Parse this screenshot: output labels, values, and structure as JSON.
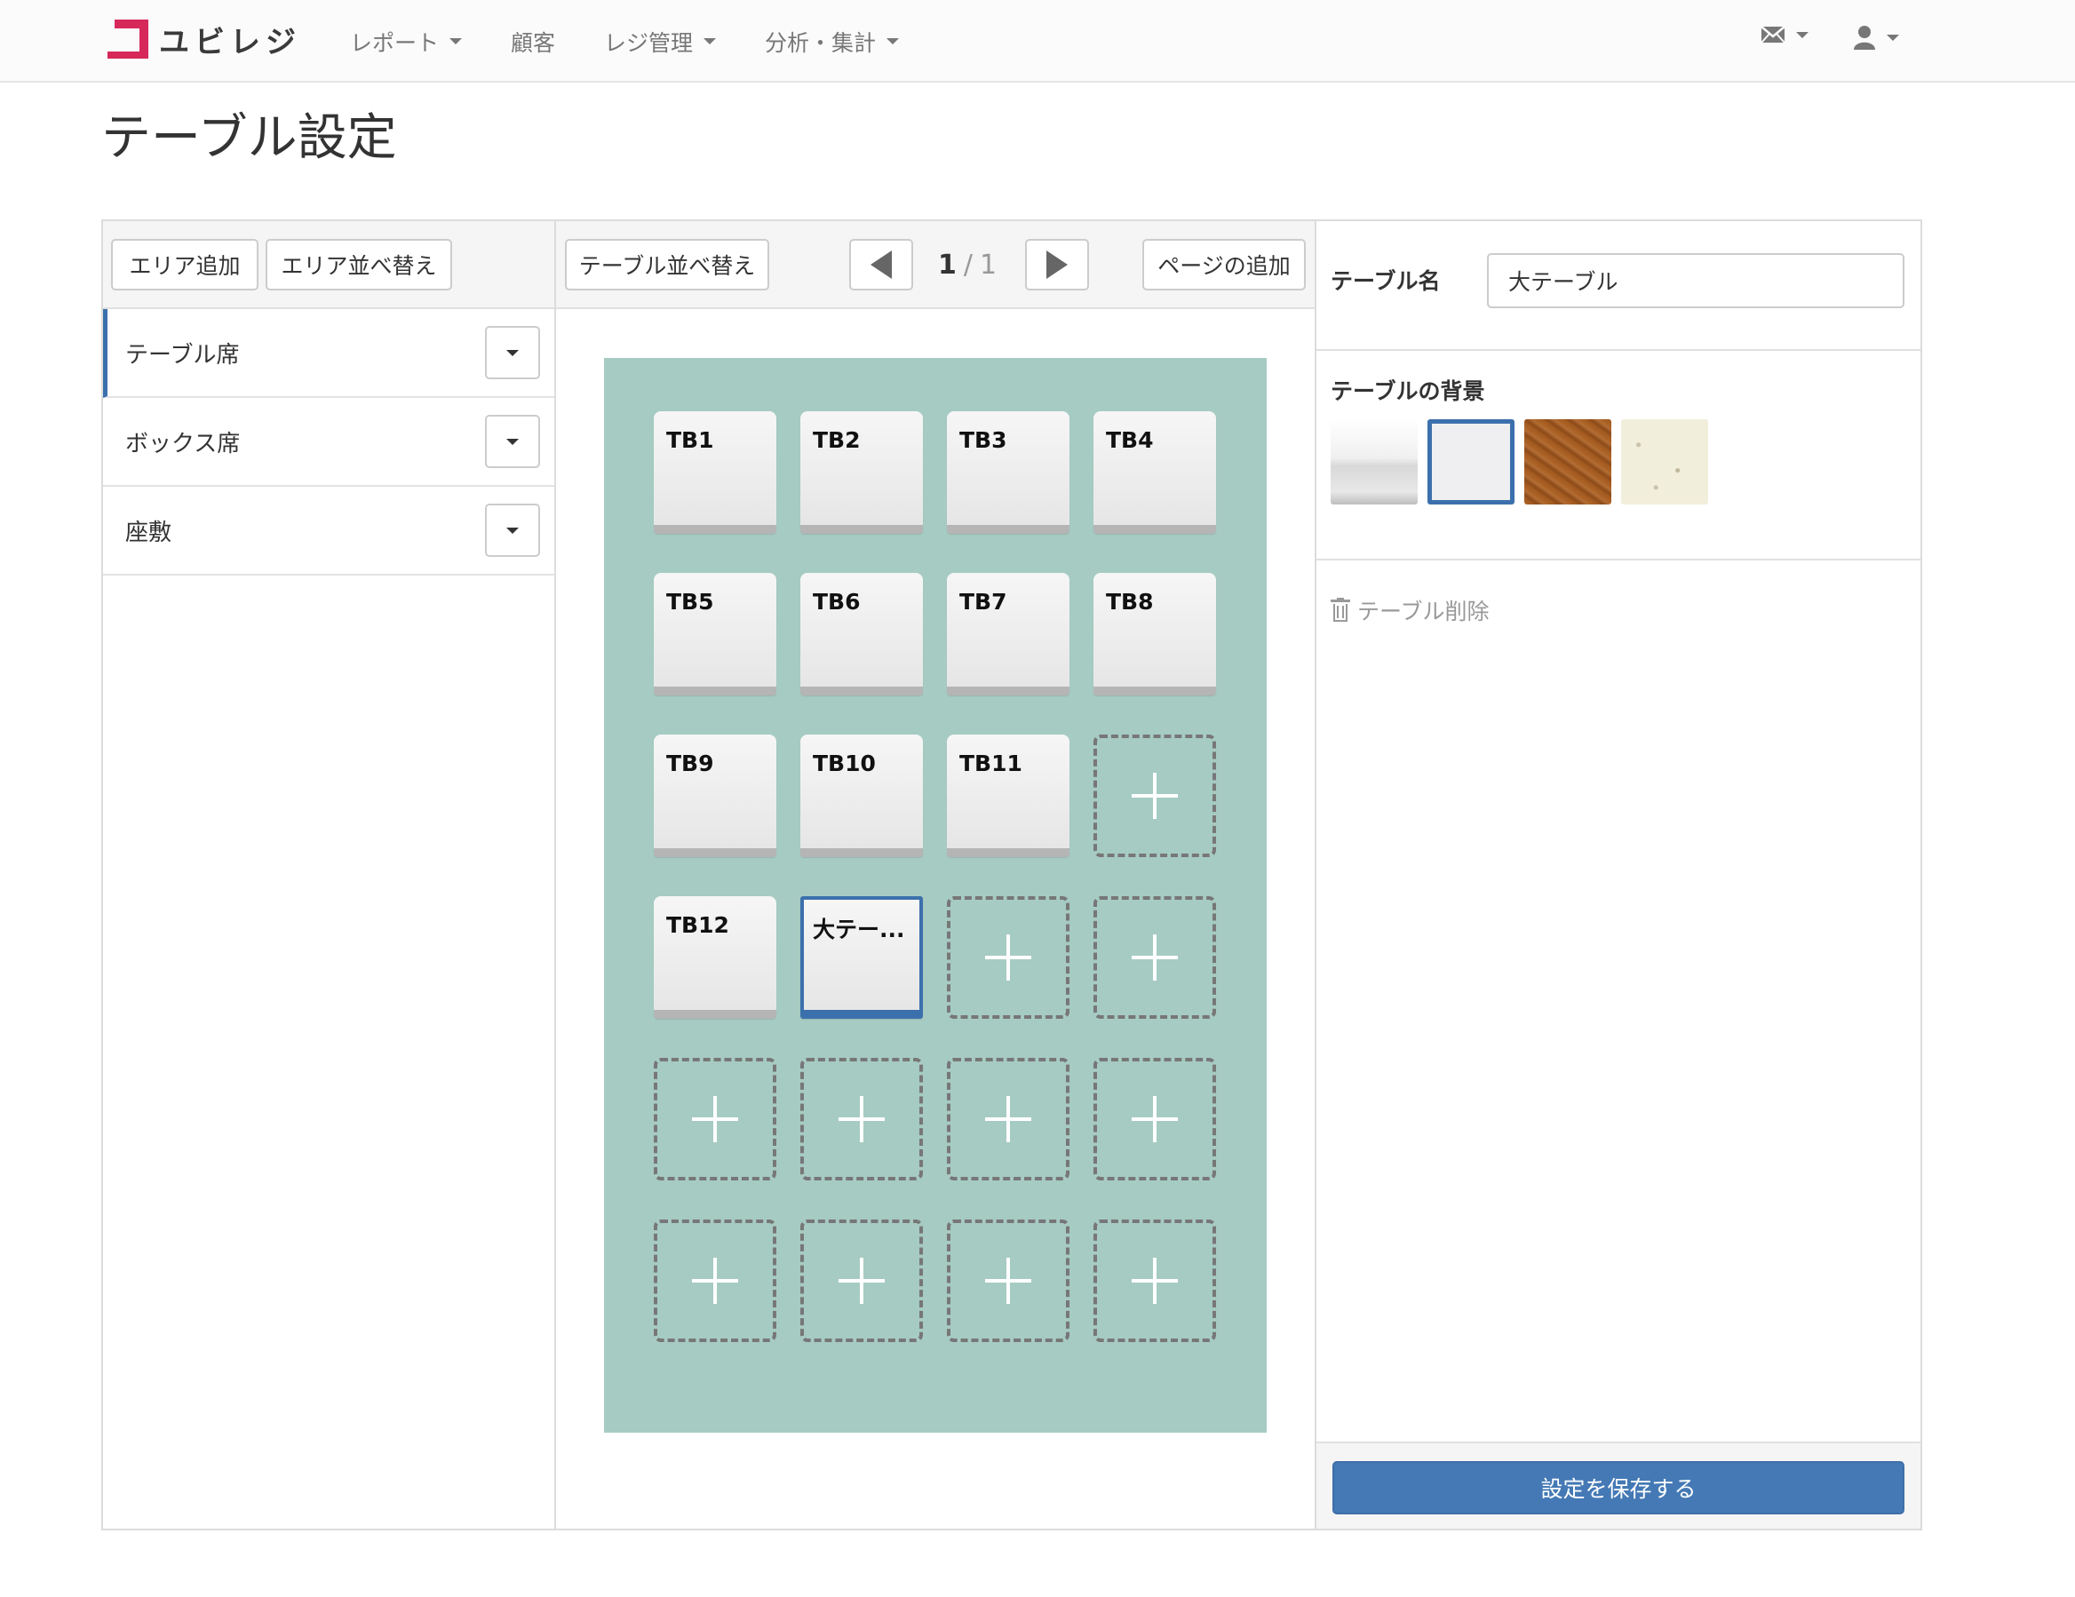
{
  "app": {
    "brand_name": "ユビレジ"
  },
  "nav": {
    "items": [
      {
        "label": "レポート",
        "dropdown": true
      },
      {
        "label": "顧客",
        "dropdown": false
      },
      {
        "label": "レジ管理",
        "dropdown": true
      },
      {
        "label": "分析・集計",
        "dropdown": true
      }
    ],
    "right_icons": [
      "mail-icon",
      "user-icon"
    ]
  },
  "page": {
    "title": "テーブル設定"
  },
  "left_panel": {
    "add_area_label": "エリア追加",
    "sort_area_label": "エリア並べ替え",
    "areas": [
      {
        "label": "テーブル席",
        "active": true
      },
      {
        "label": "ボックス席",
        "active": false
      },
      {
        "label": "座敷",
        "active": false
      }
    ]
  },
  "middle_panel": {
    "sort_tables_label": "テーブル並べ替え",
    "add_page_label": "ページの追加",
    "pager": {
      "current": "1",
      "separator": "/",
      "total": "1"
    },
    "canvas_color": "#a6cbc2",
    "grid": {
      "columns": 4,
      "rows": 6,
      "tables": [
        "TB1",
        "TB2",
        "TB3",
        "TB4",
        "TB5",
        "TB6",
        "TB7",
        "TB8",
        "TB9",
        "TB10",
        "TB11",
        "",
        "TB12",
        "大テー...",
        "",
        "",
        "",
        "",
        "",
        "",
        "",
        "",
        "",
        ""
      ],
      "selected_index": 13
    }
  },
  "right_panel": {
    "table_name_label": "テーブル名",
    "table_name_value": "大テーブル",
    "background_label": "テーブルの背景",
    "backgrounds": [
      {
        "name": "white-gloss",
        "selected": false
      },
      {
        "name": "plain-white",
        "selected": true
      },
      {
        "name": "wood",
        "selected": false
      },
      {
        "name": "speckled-cream",
        "selected": false
      }
    ],
    "delete_label": "テーブル削除",
    "save_label": "設定を保存する",
    "accent_color": "#4479b5"
  }
}
